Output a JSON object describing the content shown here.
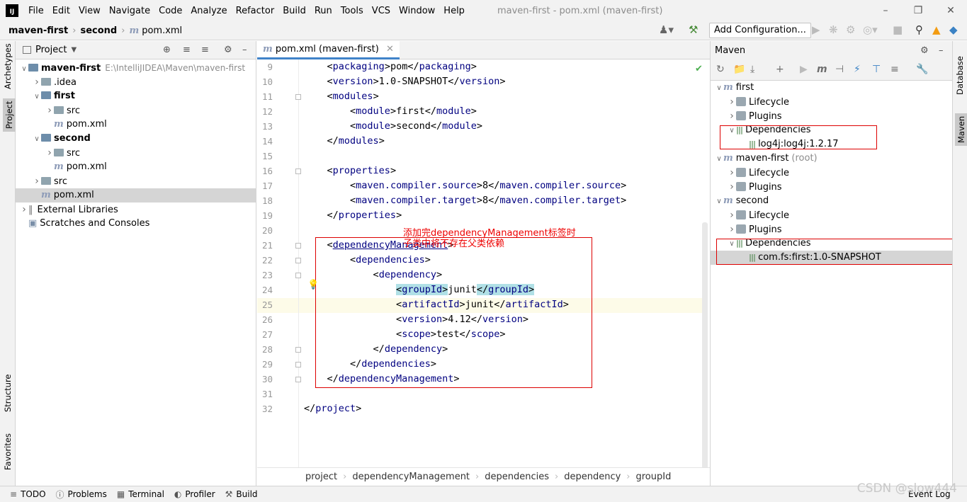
{
  "menubar": {
    "items": [
      "File",
      "Edit",
      "View",
      "Navigate",
      "Code",
      "Analyze",
      "Refactor",
      "Build",
      "Run",
      "Tools",
      "VCS",
      "Window",
      "Help"
    ],
    "window_title": "maven-first - pom.xml (maven-first)"
  },
  "navbar": {
    "crumbs": [
      "maven-first",
      "second",
      "pom.xml"
    ],
    "config_label": "Add Configuration..."
  },
  "left_strip": {
    "archetypes": "Archetypes",
    "project": "Project",
    "structure": "Structure",
    "favorites": "Favorites"
  },
  "right_strip": {
    "database": "Database",
    "maven": "Maven"
  },
  "project_panel": {
    "title": "Project",
    "tree": [
      {
        "label": "maven-first",
        "extra": "E:\\IntelliJIDEA\\Maven\\maven-first",
        "bold": true,
        "arrow": "down",
        "icon": "folder-module"
      },
      {
        "label": ".idea",
        "arrow": "right",
        "icon": "folder"
      },
      {
        "label": "first",
        "bold": true,
        "arrow": "down",
        "icon": "folder-module"
      },
      {
        "label": "src",
        "arrow": "right",
        "icon": "folder"
      },
      {
        "label": "pom.xml",
        "icon": "maven-file"
      },
      {
        "label": "second",
        "bold": true,
        "arrow": "down",
        "icon": "folder-module"
      },
      {
        "label": "src",
        "arrow": "right",
        "icon": "folder"
      },
      {
        "label": "pom.xml",
        "icon": "maven-file"
      },
      {
        "label": "src",
        "arrow": "right",
        "icon": "folder"
      },
      {
        "label": "pom.xml",
        "icon": "maven-file",
        "selected": true
      },
      {
        "label": "External Libraries",
        "arrow": "right",
        "icon": "library"
      },
      {
        "label": "Scratches and Consoles",
        "icon": "scratch"
      }
    ]
  },
  "editor": {
    "tab_label": "pom.xml (maven-first)",
    "lines": [
      {
        "n": "9",
        "indent": "    ",
        "open": "packaging",
        "text": "pom",
        "close": "packaging"
      },
      {
        "n": "10",
        "indent": "    ",
        "open": "version",
        "text": "1.0-SNAPSHOT",
        "close": "version"
      },
      {
        "n": "11",
        "indent": "    ",
        "open": "modules",
        "text": "",
        "close": ""
      },
      {
        "n": "12",
        "indent": "        ",
        "open": "module",
        "text": "first",
        "close": "module"
      },
      {
        "n": "13",
        "indent": "        ",
        "open": "module",
        "text": "second",
        "close": "module"
      },
      {
        "n": "14",
        "indent": "    ",
        "open": "",
        "text": "",
        "close": "modules"
      },
      {
        "n": "15",
        "indent": "",
        "open": "",
        "text": "",
        "close": ""
      },
      {
        "n": "16",
        "indent": "    ",
        "open": "properties",
        "text": "",
        "close": ""
      },
      {
        "n": "17",
        "indent": "        ",
        "open": "maven.compiler.source",
        "text": "8",
        "close": "maven.compiler.source"
      },
      {
        "n": "18",
        "indent": "        ",
        "open": "maven.compiler.target",
        "text": "8",
        "close": "maven.compiler.target"
      },
      {
        "n": "19",
        "indent": "    ",
        "open": "",
        "text": "",
        "close": "properties"
      },
      {
        "n": "20",
        "indent": "",
        "open": "",
        "text": "",
        "close": ""
      },
      {
        "n": "21",
        "indent": "    ",
        "open": "dependencyManagement",
        "text": "",
        "close": ""
      },
      {
        "n": "22",
        "indent": "        ",
        "open": "dependencies",
        "text": "",
        "close": ""
      },
      {
        "n": "23",
        "indent": "            ",
        "open": "dependency",
        "text": "",
        "close": ""
      },
      {
        "n": "24",
        "indent": "                ",
        "open": "groupId",
        "text": "junit",
        "close": "groupId"
      },
      {
        "n": "25",
        "indent": "                ",
        "open": "artifactId",
        "text": "junit",
        "close": "artifactId"
      },
      {
        "n": "26",
        "indent": "                ",
        "open": "version",
        "text": "4.12",
        "close": "version"
      },
      {
        "n": "27",
        "indent": "                ",
        "open": "scope",
        "text": "test",
        "close": "scope"
      },
      {
        "n": "28",
        "indent": "            ",
        "open": "",
        "text": "",
        "close": "dependency"
      },
      {
        "n": "29",
        "indent": "        ",
        "open": "",
        "text": "",
        "close": "dependencies"
      },
      {
        "n": "30",
        "indent": "    ",
        "open": "",
        "text": "",
        "close": "dependencyManagement"
      },
      {
        "n": "31",
        "indent": "",
        "open": "",
        "text": "",
        "close": ""
      },
      {
        "n": "32",
        "indent": "",
        "open": "",
        "text": "",
        "close": "project"
      }
    ],
    "annotation": "添加完dependencyManagement标签时\n子类中将不存在父类依赖",
    "breadcrumb": [
      "project",
      "dependencyManagement",
      "dependencies",
      "dependency",
      "groupId"
    ]
  },
  "maven_panel": {
    "title": "Maven",
    "tree": [
      {
        "label": "first",
        "arrow": "down",
        "icon": "module",
        "indent": 0
      },
      {
        "label": "Lifecycle",
        "arrow": "right",
        "icon": "gear",
        "indent": 1
      },
      {
        "label": "Plugins",
        "arrow": "right",
        "icon": "gear",
        "indent": 1
      },
      {
        "label": "Dependencies",
        "arrow": "down",
        "icon": "deps",
        "indent": 1
      },
      {
        "label": "log4j:log4j:1.2.17",
        "icon": "lib",
        "indent": 2
      },
      {
        "label": "maven-first",
        "extra": "(root)",
        "arrow": "down",
        "icon": "module",
        "indent": 0
      },
      {
        "label": "Lifecycle",
        "arrow": "right",
        "icon": "gear",
        "indent": 1
      },
      {
        "label": "Plugins",
        "arrow": "right",
        "icon": "gear",
        "indent": 1
      },
      {
        "label": "second",
        "arrow": "down",
        "icon": "module",
        "indent": 0
      },
      {
        "label": "Lifecycle",
        "arrow": "right",
        "icon": "gear",
        "indent": 1
      },
      {
        "label": "Plugins",
        "arrow": "right",
        "icon": "gear",
        "indent": 1
      },
      {
        "label": "Dependencies",
        "arrow": "down",
        "icon": "deps",
        "indent": 1
      },
      {
        "label": "com.fs:first:1.0-SNAPSHOT",
        "icon": "lib",
        "indent": 2,
        "selected": true
      }
    ]
  },
  "statusbar": {
    "items": [
      "TODO",
      "Problems",
      "Terminal",
      "Profiler",
      "Build"
    ],
    "event_log": "Event Log",
    "watermark": "CSDN @slow444"
  }
}
